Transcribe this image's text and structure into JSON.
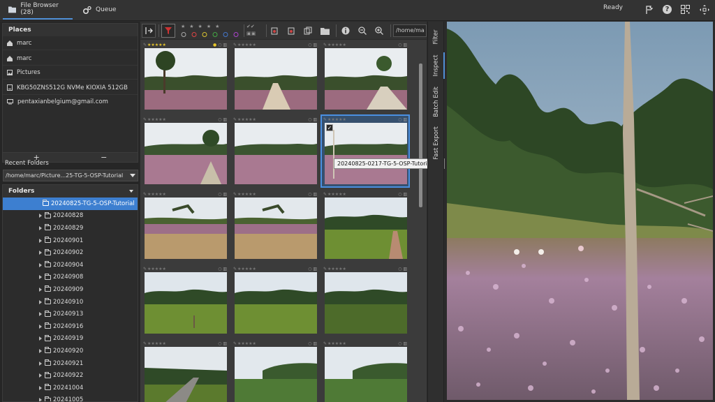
{
  "topbar": {
    "tabs": [
      {
        "label": "File Browser (28)",
        "icon": "folder-icon",
        "active": true
      },
      {
        "label": "Queue",
        "icon": "gears-icon",
        "active": false
      }
    ],
    "status": "Ready",
    "icons": [
      "flag-arrow-icon",
      "help-icon",
      "qr-grid-icon",
      "move-icon"
    ]
  },
  "places": {
    "title": "Places",
    "items": [
      {
        "label": "marc",
        "icon": "home-icon"
      },
      {
        "label": "marc",
        "icon": "home-icon"
      },
      {
        "label": "Pictures",
        "icon": "pictures-icon"
      },
      {
        "label": "KBG50ZNS512G NVMe KIOXIA 512GB",
        "icon": "drive-icon"
      },
      {
        "label": "pentaxianbelgium@gmail.com",
        "icon": "cloud-account-icon"
      }
    ],
    "add": "+",
    "remove": "−"
  },
  "recent": {
    "title": "Recent Folders",
    "value": "/home/marc/Picture...25-TG-5-OSP-Tutorial"
  },
  "folders": {
    "title": "Folders",
    "selected": "20240825-TG-5-OSP-Tutorial",
    "items": [
      "20240828",
      "20240829",
      "20240901",
      "20240902",
      "20240904",
      "20240908",
      "20240909",
      "20240910",
      "20240913",
      "20240916",
      "20240919",
      "20240920",
      "20240921",
      "20240922",
      "20241004",
      "20241005"
    ]
  },
  "toolbar": {
    "path": "/home/ma"
  },
  "tooltip": "20240825-0217-TG-5-OSP-Tutorial.orf",
  "vtabs": [
    "Filter",
    "Inspect",
    "Batch Edit",
    "Fast Export"
  ],
  "colors": {
    "accent": "#3d7fd0",
    "sky": "#dfe6ec",
    "heather": "#a67b98",
    "grass": "#6a8a3a",
    "trees": "#2f4a28"
  }
}
